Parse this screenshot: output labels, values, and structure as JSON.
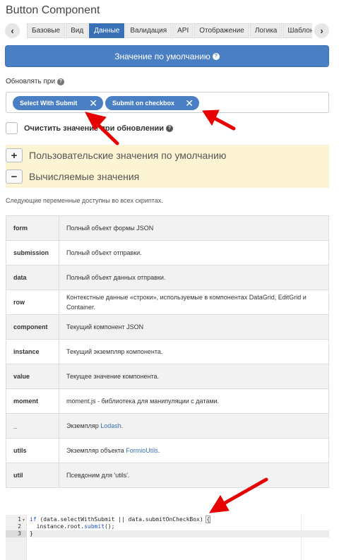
{
  "header": {
    "title": "Button Component"
  },
  "tabs": {
    "prev_icon": "chevron-left-icon",
    "next_icon": "chevron-right-icon",
    "items": [
      {
        "label": "Базовые"
      },
      {
        "label": "Вид"
      },
      {
        "label": "Данные",
        "active": true
      },
      {
        "label": "Валидация"
      },
      {
        "label": "API"
      },
      {
        "label": "Отображение"
      },
      {
        "label": "Логика"
      },
      {
        "label": "Шаблон"
      }
    ]
  },
  "default_value_button": {
    "label": "Значение по умолчанию"
  },
  "refresh_on": {
    "label": "Обновлять при",
    "chips": [
      {
        "label": "Select With Submit"
      },
      {
        "label": "Submit on checkbox"
      }
    ],
    "remove_glyph": "✕"
  },
  "clear_on_refresh": {
    "label": "Очистить значение при обновлении",
    "checked": false
  },
  "panels": {
    "custom_default": {
      "toggle": "+",
      "title": "Пользовательские значения по умолчанию"
    },
    "calculated": {
      "toggle": "−",
      "title": "Вычисляемые значения"
    }
  },
  "vars_note": "Следующие переменные доступны во всех скриптах.",
  "vars_table": [
    {
      "key": "form",
      "desc": "Полный объект формы JSON"
    },
    {
      "key": "submission",
      "desc": "Полный объект отправки."
    },
    {
      "key": "data",
      "desc": "Полный объект данных отправки."
    },
    {
      "key": "row",
      "desc": "Контекстные данные «строки», используемые в компонентах DataGrid, EditGrid и Container."
    },
    {
      "key": "component",
      "desc": "Текущий компонент JSON"
    },
    {
      "key": "instance",
      "desc": "Текущий экземпляр компонента."
    },
    {
      "key": "value",
      "desc": "Текущее значение компонента."
    },
    {
      "key": "moment",
      "desc": "moment.js - библиотека для манипуляции с датами."
    },
    {
      "key": "_",
      "desc_prefix": "Экземпляр ",
      "desc_link": "Lodash",
      "desc_suffix": "."
    },
    {
      "key": "utils",
      "desc_prefix": "Экземпляр объекта ",
      "desc_link": "FormioUtils",
      "desc_suffix": "."
    },
    {
      "key": "util",
      "desc": "Псевдоним для 'utils'."
    }
  ],
  "code_editor": {
    "line_numbers": [
      "1",
      "2",
      "3"
    ],
    "lines": {
      "l1_kw": "if",
      "l1_rest": " (data.selectWithSubmit || data.submitOnCheckBox) ",
      "l1_brace": "{",
      "l2_indent": "  instance.root.",
      "l2_fn": "submit",
      "l2_end": "();",
      "l3": "}"
    }
  },
  "colors": {
    "primary": "#4a7fc3",
    "active_tab": "#3a70b5",
    "panel_bg": "#fdf4d4",
    "annotation_arrow": "#e60000"
  }
}
